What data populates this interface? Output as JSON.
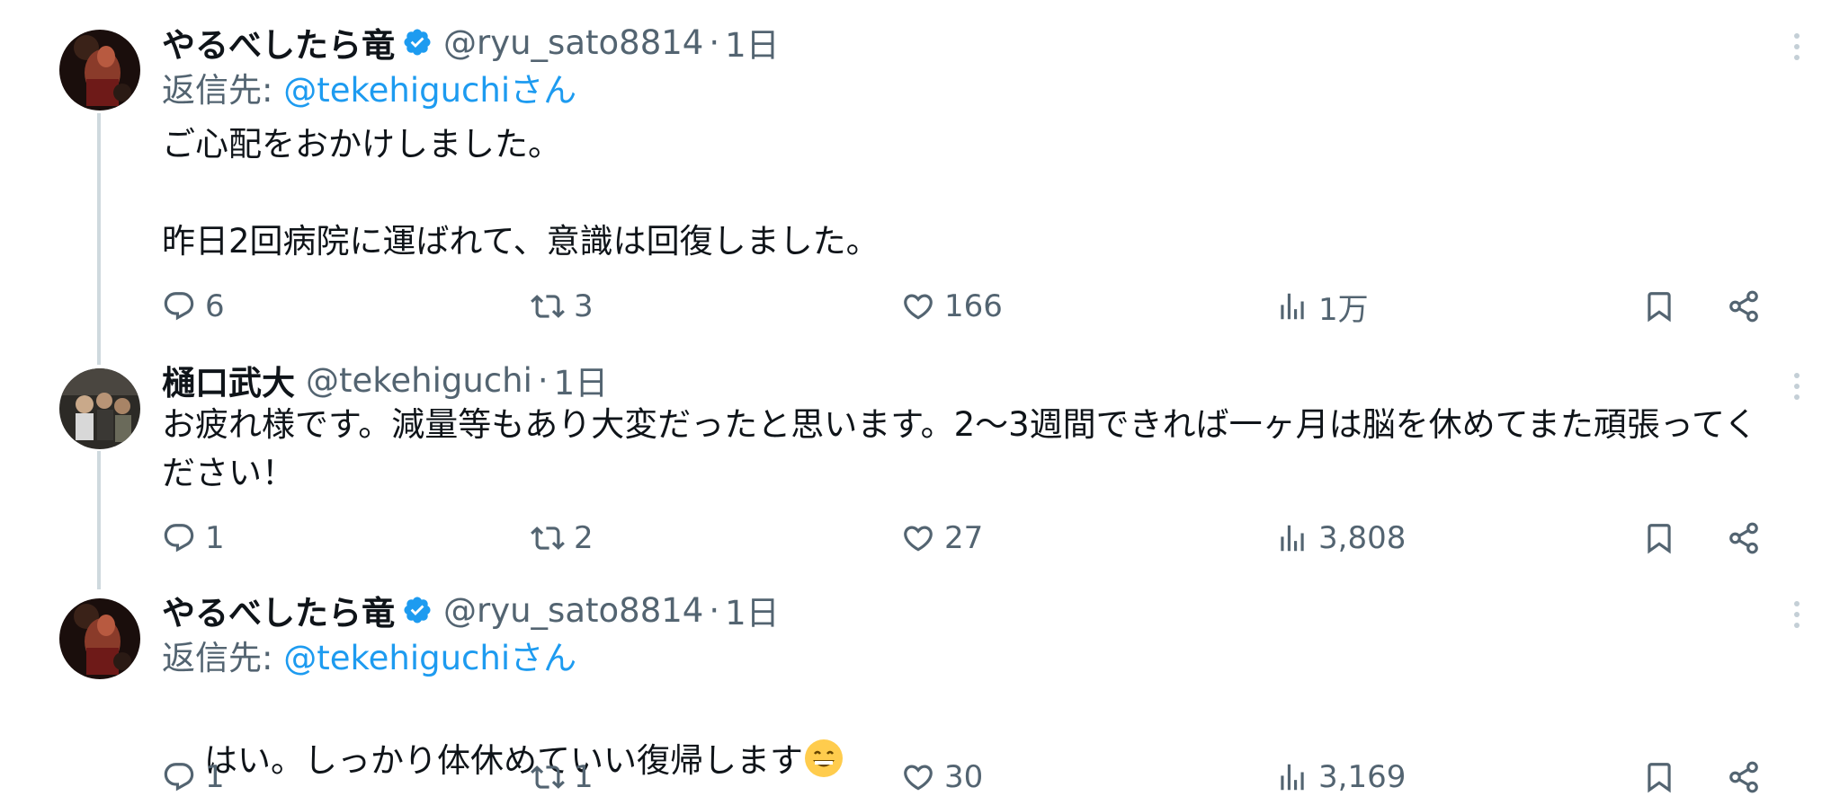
{
  "tweets": [
    {
      "display_name": "やるべしたら竜",
      "verified": true,
      "handle": "@ryu_sato8814",
      "separator": "·",
      "time": "1日",
      "reply_to_prefix": "返信先: ",
      "reply_to_mention": "@tekehiguchi",
      "reply_to_suffix": "さん",
      "text": "ご心配をおかけしました。\n\n昨日2回病院に運ばれて、意識は回復しました。",
      "replies": "6",
      "retweets": "3",
      "likes": "166",
      "views": "1万"
    },
    {
      "display_name": "樋口武大",
      "verified": false,
      "handle": "@tekehiguchi",
      "separator": "·",
      "time": "1日",
      "text": "お疲れ様です。減量等もあり大変だったと思います。2〜3週間できれば一ヶ月は脳を休めてまた頑張ってください！",
      "replies": "1",
      "retweets": "2",
      "likes": "27",
      "views": "3,808"
    },
    {
      "display_name": "やるべしたら竜",
      "verified": true,
      "handle": "@ryu_sato8814",
      "separator": "·",
      "time": "1日",
      "reply_to_prefix": "返信先: ",
      "reply_to_mention": "@tekehiguchi",
      "reply_to_suffix": "さん",
      "text": "はい。しっかり体休めていい復帰します",
      "emoji": "grinning-face-emoji",
      "replies": "1",
      "retweets": "1",
      "likes": "30",
      "views": "3,169"
    }
  ],
  "icons": {
    "reply": "reply-icon",
    "retweet": "retweet-icon",
    "like": "heart-icon",
    "views": "views-icon",
    "bookmark": "bookmark-icon",
    "share": "share-icon",
    "more": "more-icon",
    "verified": "verified-badge-icon"
  },
  "colors": {
    "text": "#0f1419",
    "secondary": "#536471",
    "link": "#1d9bf0",
    "thread_line": "#cfd9de"
  }
}
